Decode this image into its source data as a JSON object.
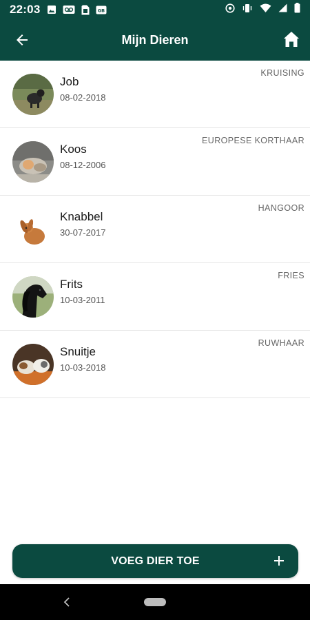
{
  "status_bar": {
    "time": "22:03",
    "left_icons": [
      "gallery-icon",
      "voicemail-icon",
      "sim-icon",
      "sd-card-icon"
    ],
    "right_icons": [
      "sync-icon",
      "vibrate-icon",
      "wifi-icon",
      "signal-icon",
      "battery-icon"
    ]
  },
  "app_bar": {
    "title": "Mijn Dieren",
    "back_icon": "arrow-left-icon",
    "home_icon": "home-icon"
  },
  "animals": [
    {
      "name": "Job",
      "date": "08-02-2018",
      "breed": "KRUISING"
    },
    {
      "name": "Koos",
      "date": "08-12-2006",
      "breed": "EUROPESE KORTHAAR"
    },
    {
      "name": "Knabbel",
      "date": "30-07-2017",
      "breed": "HANGOOR"
    },
    {
      "name": "Frits",
      "date": "10-03-2011",
      "breed": "FRIES"
    },
    {
      "name": "Snuitje",
      "date": "10-03-2018",
      "breed": "RUWHAAR"
    }
  ],
  "add_button": {
    "label": "VOEG DIER TOE",
    "icon": "plus-icon"
  },
  "colors": {
    "primary": "#0b4a40",
    "text": "#1b1b1b",
    "subtext": "#555555"
  }
}
